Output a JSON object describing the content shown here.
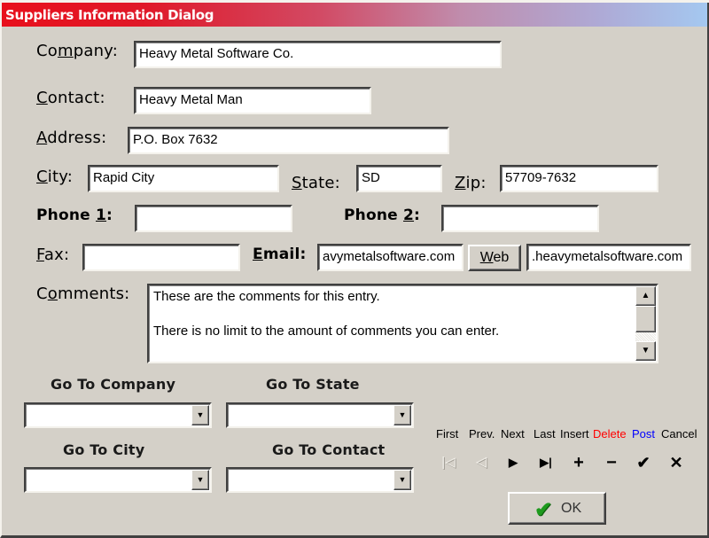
{
  "window": {
    "title": "Suppliers Information Dialog",
    "title_gradient": [
      "#e8101c",
      "#a4c8f0"
    ]
  },
  "form": {
    "company": {
      "label_pre": "Co",
      "label_u": "m",
      "label_post": "pany:",
      "value": "Heavy Metal Software Co."
    },
    "contact": {
      "label_pre": "",
      "label_u": "C",
      "label_post": "ontact:",
      "value": "Heavy Metal Man"
    },
    "address": {
      "label_pre": "",
      "label_u": "A",
      "label_post": "ddress:",
      "value": "P.O. Box 7632"
    },
    "city": {
      "label_pre": "",
      "label_u": "C",
      "label_post": "ity:",
      "value": "Rapid City"
    },
    "state": {
      "label_pre": "",
      "label_u": "S",
      "label_post": "tate:",
      "value": "SD"
    },
    "zip": {
      "label_pre": "",
      "label_u": "Z",
      "label_post": "ip:",
      "value": "57709-7632"
    },
    "phone1": {
      "label_pre": "Phone ",
      "label_u": "1",
      "label_post": ":",
      "value": ""
    },
    "phone2": {
      "label_pre": "Phone ",
      "label_u": "2",
      "label_post": ":",
      "value": ""
    },
    "fax": {
      "label_pre": "",
      "label_u": "F",
      "label_post": "ax:",
      "value": ""
    },
    "email": {
      "label_pre": "",
      "label_u": "E",
      "label_post": "mail:",
      "value": "avymetalsoftware.com"
    },
    "web_button": {
      "label_pre": "",
      "label_u": "W",
      "label_post": "eb"
    },
    "web": {
      "value": ".heavymetalsoftware.com"
    },
    "comments": {
      "label_pre": "C",
      "label_u": "o",
      "label_post": "mments:",
      "lines": [
        "These are the comments for this entry.",
        "",
        "There is no limit to the amount of comments you can enter."
      ]
    }
  },
  "goto": {
    "company": {
      "label": "Go To Company",
      "value": ""
    },
    "state": {
      "label": "Go To State",
      "value": ""
    },
    "city": {
      "label": "Go To City",
      "value": ""
    },
    "contact": {
      "label": "Go To Contact",
      "value": ""
    }
  },
  "navigator": {
    "captions": [
      {
        "text": "First",
        "color": "#000000"
      },
      {
        "text": "Prev.",
        "color": "#000000"
      },
      {
        "text": "Next",
        "color": "#000000"
      },
      {
        "text": "Last",
        "color": "#000000"
      },
      {
        "text": "Insert",
        "color": "#000000"
      },
      {
        "text": "Delete",
        "color": "#ff0000"
      },
      {
        "text": "Post",
        "color": "#0000ff"
      },
      {
        "text": "Cancel",
        "color": "#000000"
      }
    ],
    "buttons": [
      {
        "icon": "first-record-icon",
        "glyph": "⏮",
        "enabled": false
      },
      {
        "icon": "prior-record-icon",
        "glyph": "◁",
        "enabled": false
      },
      {
        "icon": "next-record-icon",
        "glyph": "▶",
        "enabled": true
      },
      {
        "icon": "last-record-icon",
        "glyph": "▶|",
        "enabled": true
      },
      {
        "icon": "insert-icon",
        "glyph": "✚",
        "enabled": true
      },
      {
        "icon": "delete-icon",
        "glyph": "━",
        "enabled": true
      },
      {
        "icon": "post-icon",
        "glyph": "✔",
        "enabled": true
      },
      {
        "icon": "cancel-icon",
        "glyph": "✖",
        "enabled": true
      }
    ]
  },
  "ok_button": {
    "label": "OK",
    "check_color": "#1e9a1e"
  }
}
